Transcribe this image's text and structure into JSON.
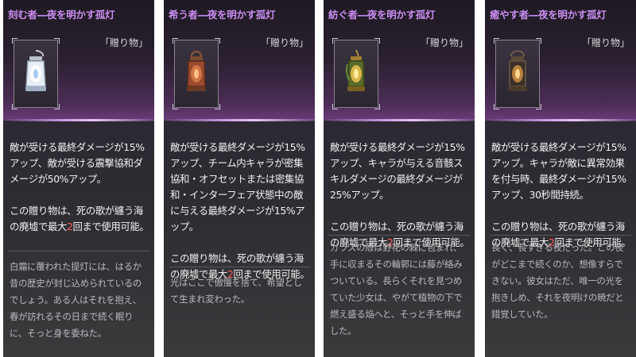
{
  "cards": [
    {
      "title": "刻む者―夜を明かす孤灯",
      "category": "「贈り物」",
      "lantern_icon": "white-blue-lantern-icon",
      "lantern_color": "#cfe0f0",
      "effect": "敵が受ける最終ダメージが15%アップ、敵が受ける震撃協和ダメージが50%アップ。",
      "usage_pre": "この贈り物は、死の歌が纏う海の廃墟で最大",
      "usage_num": "2",
      "usage_post": "回まで使用可能。",
      "flavor": "白霜に覆われた提灯には、はるか昔の歴史が封じ込められているのでしょう。ある人はそれを抱え、春が訪れるその日まで続く眠りに、そっと身を委ねた。"
    },
    {
      "title": "希う者―夜を明かす孤灯",
      "category": "「贈り物」",
      "lantern_icon": "red-copper-lantern-icon",
      "lantern_color": "#c0603a",
      "effect": "敵が受ける最終ダメージが15%アップ、チーム内キャラが密集協和・オフセットまたは密集協和・インターフェア状態中の敵に与える最終ダメージが15%アップ。",
      "usage_pre": "この贈り物は、死の歌が纏う海の廃墟で最大",
      "usage_num": "2",
      "usage_post": "回まで使用可能。",
      "flavor": "光はここで傲慢を捨て、希望として生まれ変わった。"
    },
    {
      "title": "紡ぐ者―夜を明かす孤灯",
      "category": "「贈り物」",
      "lantern_icon": "gold-green-lantern-icon",
      "lantern_color": "#d8b040",
      "effect": "敵が受ける最終ダメージが15%アップ、キャラが与える音骸スキルダメージの最終ダメージが25%アップ。",
      "usage_pre": "この贈り物は、死の歌が纏う海の廃墟で最大",
      "usage_num": "2",
      "usage_post": "回まで使用可能。",
      "flavor": "ガラスの殻は野花の棘に包まれ、手に収まるその輪郭には藤が絡みついている。長らくそれを見つめていた少女は、やがて植物の下で燃え盛る焔へと、そっと手を伸ばした。"
    },
    {
      "title": "癒やす者―夜を明かす孤灯",
      "category": "「贈り物」",
      "lantern_icon": "dark-bronze-lantern-icon",
      "lantern_color": "#e8b060",
      "effect": "敵が受ける最終ダメージが15%アップ。キャラが敵に異常効果を付与時、最終ダメージが15%アップ、30秒間持続。",
      "usage_pre": "この贈り物は、死の歌が纏う海の廃墟で最大",
      "usage_num": "2",
      "usage_post": "回まで使用可能。",
      "flavor": "長く、長すぎる夜だった。この夜がどこまで続くのか、想像すらできない。彼女はただ、唯一の光を抱きしめ、それを夜明けの暁だと錯覚していた。"
    }
  ],
  "colors": {
    "title": "#c98ef2",
    "highlight": "#ff5b5b",
    "accent_glow": "#c89ae0"
  }
}
